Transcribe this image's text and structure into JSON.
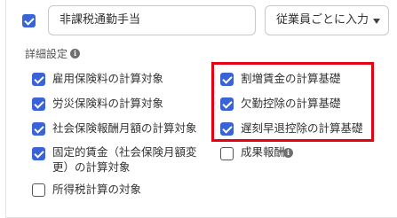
{
  "allowance": {
    "enabled": true,
    "name_value": "非課税通勤手当",
    "input_method": "従業員ごとに入力"
  },
  "details": {
    "title": "詳細設定",
    "info_icon": "info-icon",
    "left": [
      {
        "label": "雇用保険料の計算対象",
        "checked": true
      },
      {
        "label": "労災保険料の計算対象",
        "checked": true
      },
      {
        "label": "社会保険報酬月額の計算対象",
        "checked": true
      },
      {
        "label_line1": "固定的賃金（社会保険月額変",
        "label_line2": "更）の計算対象",
        "checked": true
      },
      {
        "label": "所得税計算の対象",
        "checked": false
      }
    ],
    "right": [
      {
        "label": "割増賃金の計算基礎",
        "checked": true
      },
      {
        "label": "欠勤控除の計算基礎",
        "checked": true
      },
      {
        "label": "遅刻早退控除の計算基礎",
        "checked": true
      },
      {
        "label": "成果報酬",
        "checked": false
      }
    ]
  },
  "colors": {
    "checkbox_checked": "#3b63d8",
    "highlight_border": "#e60012"
  }
}
